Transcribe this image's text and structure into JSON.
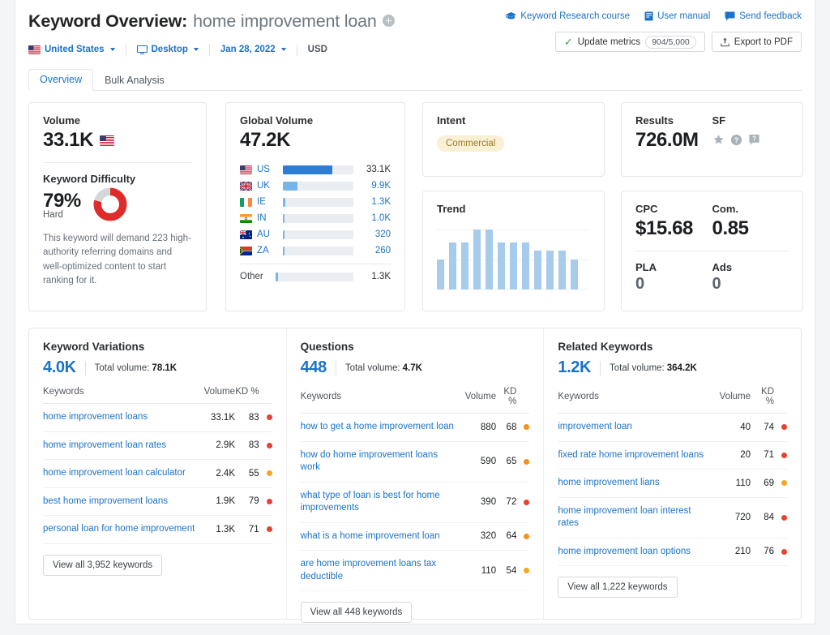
{
  "header": {
    "title_main": "Keyword Overview:",
    "keyword": "home improvement loan",
    "add_icon": "plus-circle-icon",
    "links": [
      {
        "label": "Keyword Research course",
        "icon": "graduation-cap-icon"
      },
      {
        "label": "User manual",
        "icon": "book-icon"
      },
      {
        "label": "Send feedback",
        "icon": "speech-bubble-icon"
      }
    ],
    "filters": {
      "country": "United States",
      "country_flag": "us-flag-icon",
      "device": "Desktop",
      "device_icon": "monitor-icon",
      "date": "Jan 28, 2022",
      "currency": "USD"
    },
    "buttons": {
      "update_metrics": "Update metrics",
      "update_metrics_quota": "904/5,000",
      "export_pdf": "Export to PDF",
      "export_icon": "upload-icon"
    }
  },
  "tabs": [
    {
      "label": "Overview",
      "active": true
    },
    {
      "label": "Bulk Analysis",
      "active": false
    }
  ],
  "volume_card": {
    "label": "Volume",
    "value": "33.1K",
    "flag": "us-flag-icon",
    "kd_label": "Keyword Difficulty",
    "kd_value": "79%",
    "kd_percent": 79,
    "kd_level": "Hard",
    "kd_color": "#e02b2b",
    "kd_track_color": "#d4d7da",
    "kd_note": "This keyword will demand 223 high-authority referring domains and well-optimized content to start ranking for it."
  },
  "global_volume_card": {
    "label": "Global Volume",
    "value": "47.2K",
    "other_label": "Other",
    "rows": [
      {
        "code": "US",
        "flag": "us-flag-icon",
        "value": "33.1K",
        "pct": 70,
        "color": "#2d7dd2",
        "dark": true
      },
      {
        "code": "UK",
        "flag": "uk-flag-icon",
        "value": "9.9K",
        "pct": 21,
        "color": "#76b4ec",
        "dark": false
      },
      {
        "code": "IE",
        "flag": "ie-flag-icon",
        "value": "1.3K",
        "pct": 3,
        "color": "#76b4ec",
        "dark": false
      },
      {
        "code": "IN",
        "flag": "in-flag-icon",
        "value": "1.0K",
        "pct": 2.5,
        "color": "#76b4ec",
        "dark": false
      },
      {
        "code": "AU",
        "flag": "au-flag-icon",
        "value": "320",
        "pct": 2,
        "color": "#76b4ec",
        "dark": false
      },
      {
        "code": "ZA",
        "flag": "za-flag-icon",
        "value": "260",
        "pct": 2,
        "color": "#76b4ec",
        "dark": false
      }
    ],
    "other": {
      "value": "1.3K",
      "pct": 3,
      "color": "#76b4ec"
    }
  },
  "intent_card": {
    "label": "Intent",
    "badge": "Commercial",
    "badge_bg": "#faf0d5",
    "badge_fg": "#9a7d2a"
  },
  "results_card": {
    "results_label": "Results",
    "results_value": "726.0M",
    "sf_label": "SF",
    "sf_icons": [
      "star-icon",
      "question-circle-icon",
      "question-bubble-icon"
    ]
  },
  "trend_card": {
    "label": "Trend"
  },
  "cpc_card": {
    "cpc_label": "CPC",
    "cpc_value": "$15.68",
    "com_label": "Com.",
    "com_value": "0.85",
    "pla_label": "PLA",
    "pla_value": "0",
    "ads_label": "Ads",
    "ads_value": "0"
  },
  "chart_data": {
    "type": "bar",
    "title": "Trend",
    "xlabel": "",
    "ylabel": "",
    "categories": [
      "1",
      "2",
      "3",
      "4",
      "5",
      "6",
      "7",
      "8",
      "9",
      "10",
      "11",
      "12"
    ],
    "values": [
      50,
      78,
      78,
      100,
      100,
      78,
      78,
      78,
      65,
      65,
      65,
      50
    ],
    "ylim": [
      0,
      100
    ],
    "grid": true,
    "legend": "none",
    "bar_color": "#a7cbea"
  },
  "columns": [
    {
      "title": "Keyword Variations",
      "count": "4.0K",
      "total_volume_label": "Total volume:",
      "total_volume": "78.1K",
      "headers": {
        "keywords": "Keywords",
        "volume": "Volume",
        "kd": "KD %"
      },
      "rows": [
        {
          "keyword": "home improvement loans",
          "volume": "33.1K",
          "kd": "83",
          "dot": "#e8412d"
        },
        {
          "keyword": "home improvement loan rates",
          "volume": "2.9K",
          "kd": "83",
          "dot": "#e8412d"
        },
        {
          "keyword": "home improvement loan calculator",
          "volume": "2.4K",
          "kd": "55",
          "dot": "#f5a623"
        },
        {
          "keyword": "best home improvement loans",
          "volume": "1.9K",
          "kd": "79",
          "dot": "#e8412d"
        },
        {
          "keyword": "personal loan for home improvement",
          "volume": "1.3K",
          "kd": "71",
          "dot": "#e8412d"
        }
      ],
      "view_all": "View all 3,952 keywords"
    },
    {
      "title": "Questions",
      "count": "448",
      "total_volume_label": "Total volume:",
      "total_volume": "4.7K",
      "headers": {
        "keywords": "Keywords",
        "volume": "Volume",
        "kd": "KD %"
      },
      "rows": [
        {
          "keyword": "how to get a home improvement loan",
          "volume": "880",
          "kd": "68",
          "dot": "#f5901e"
        },
        {
          "keyword": "how do home improvement loans work",
          "volume": "590",
          "kd": "65",
          "dot": "#f5901e"
        },
        {
          "keyword": "what type of loan is best for home improvements",
          "volume": "390",
          "kd": "72",
          "dot": "#e8412d"
        },
        {
          "keyword": "what is a home improvement loan",
          "volume": "320",
          "kd": "64",
          "dot": "#f5901e"
        },
        {
          "keyword": "are home improvement loans tax deductible",
          "volume": "110",
          "kd": "54",
          "dot": "#f5a623"
        }
      ],
      "view_all": "View all 448 keywords"
    },
    {
      "title": "Related Keywords",
      "count": "1.2K",
      "total_volume_label": "Total volume:",
      "total_volume": "364.2K",
      "headers": {
        "keywords": "Keywords",
        "volume": "Volume",
        "kd": "KD %"
      },
      "rows": [
        {
          "keyword": "improvement loan",
          "volume": "40",
          "kd": "74",
          "dot": "#e8412d"
        },
        {
          "keyword": "fixed rate home improvement loans",
          "volume": "20",
          "kd": "71",
          "dot": "#e8412d"
        },
        {
          "keyword": "home improvement lians",
          "volume": "110",
          "kd": "69",
          "dot": "#f5a623"
        },
        {
          "keyword": "home improvement loan interest rates",
          "volume": "720",
          "kd": "84",
          "dot": "#e8412d"
        },
        {
          "keyword": "home improvement loan options",
          "volume": "210",
          "kd": "76",
          "dot": "#e8412d"
        }
      ],
      "view_all": "View all 1,222 keywords"
    }
  ]
}
